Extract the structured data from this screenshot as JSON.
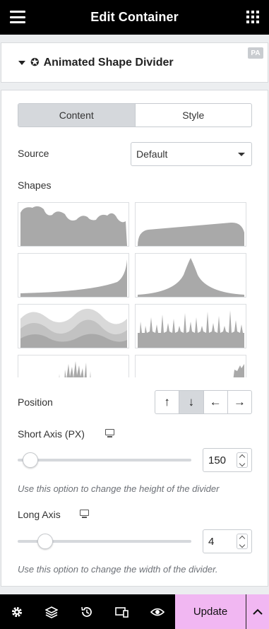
{
  "header": {
    "title": "Edit Container",
    "menu_icon": "hamburger-menu-icon",
    "apps_icon": "grid-apps-icon"
  },
  "section": {
    "title": "Animated Shape Divider",
    "icon": "star-circle-icon",
    "badge": "PA"
  },
  "tabs": [
    {
      "label": "Content",
      "active": true
    },
    {
      "label": "Style",
      "active": false
    }
  ],
  "source": {
    "label": "Source",
    "value": "Default"
  },
  "shapes": {
    "label": "Shapes",
    "items": [
      "clouds",
      "slope",
      "curve-right",
      "peak",
      "waves",
      "drips",
      "grass",
      "corner"
    ]
  },
  "position": {
    "label": "Position",
    "options": [
      {
        "name": "up",
        "glyph": "↑",
        "active": false
      },
      {
        "name": "down",
        "glyph": "↓",
        "active": true
      },
      {
        "name": "left",
        "glyph": "←",
        "active": false
      },
      {
        "name": "right",
        "glyph": "→",
        "active": false
      }
    ]
  },
  "short_axis": {
    "label": "Short Axis (PX)",
    "value": "150",
    "help": "Use this option to change the height of the divider"
  },
  "long_axis": {
    "label": "Long Axis",
    "value": "4",
    "help": "Use this option to change the width of the divider."
  },
  "footer": {
    "update_label": "Update",
    "icons": [
      "settings-icon",
      "layers-icon",
      "history-icon",
      "responsive-icon",
      "preview-eye-icon",
      "chevron-up-icon"
    ]
  },
  "colors": {
    "bar_bg": "#000000",
    "update_bg": "#f1b7f2",
    "active_tab_bg": "#d5d8dc",
    "shape_fill": "#a9a9a9"
  }
}
